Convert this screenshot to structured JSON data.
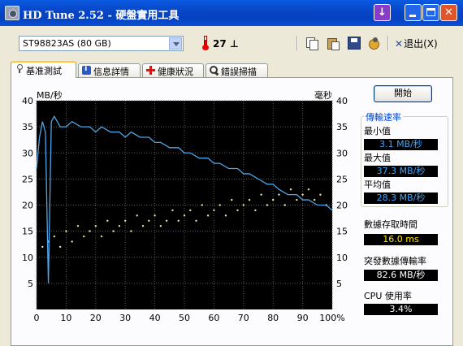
{
  "window": {
    "title": "HD Tune 2.52 - 硬盤實用工具"
  },
  "toolbar": {
    "drive": "ST98823AS (80 GB)",
    "temperature": "27 ⊥",
    "exit_label": "退出(X)"
  },
  "tabs": [
    {
      "label": "基准測試",
      "active": true
    },
    {
      "label": "信息詳情"
    },
    {
      "label": "健康狀況"
    },
    {
      "label": "錯誤掃描"
    }
  ],
  "benchmark": {
    "start_label": "開始",
    "transfer_rate_title": "傳輸速率",
    "min_label": "最小值",
    "min_value": "3.1 MB/秒",
    "max_label": "最大值",
    "max_value": "37.3 MB/秒",
    "avg_label": "平均值",
    "avg_value": "28.3 MB/秒",
    "access_time_label": "數據存取時間",
    "access_time_value": "16.0 ms",
    "burst_rate_label": "突發數據傳輸率",
    "burst_rate_value": "82.6 MB/秒",
    "cpu_label": "CPU 使用率",
    "cpu_value": "3.4%"
  },
  "colors": {
    "titlebar": "#0a5ae0",
    "chart_bg": "#000000",
    "transfer_line": "#4ea6e8",
    "access_dots": "#e6e6a0",
    "group_title": "#0046d5"
  },
  "chart_data": {
    "type": "line",
    "xlabel": "",
    "ylabel_left": "MB/秒",
    "ylabel_right": "毫秒",
    "xlim": [
      0,
      100
    ],
    "ylim": [
      0,
      40
    ],
    "x_ticks": [
      "0",
      "10",
      "20",
      "30",
      "40",
      "50",
      "60",
      "70",
      "80",
      "90",
      "100%"
    ],
    "y_ticks": [
      "5",
      "10",
      "15",
      "20",
      "25",
      "30",
      "35",
      "40"
    ],
    "grid": true,
    "series": [
      {
        "name": "transfer rate",
        "x": [
          0,
          1,
          2,
          3,
          4,
          5,
          6,
          7,
          8,
          10,
          12,
          15,
          18,
          20,
          22,
          25,
          28,
          30,
          32,
          35,
          38,
          40,
          42,
          45,
          48,
          50,
          52,
          55,
          58,
          60,
          62,
          65,
          68,
          70,
          72,
          75,
          78,
          80,
          82,
          85,
          88,
          90,
          92,
          95,
          98,
          100
        ],
        "y": [
          27,
          33,
          36,
          34,
          5,
          36,
          37,
          36,
          35,
          35,
          36,
          35,
          35,
          34,
          35,
          34,
          34,
          33,
          34,
          33,
          33,
          32,
          32,
          31,
          31,
          30,
          30,
          29,
          29,
          28,
          28,
          27,
          27,
          26,
          26,
          25,
          24,
          24,
          23,
          22,
          22,
          21,
          21,
          20,
          20,
          19
        ]
      },
      {
        "name": "access time",
        "type": "scatter",
        "x": [
          2,
          4,
          6,
          8,
          10,
          12,
          14,
          16,
          18,
          20,
          22,
          24,
          26,
          28,
          30,
          32,
          34,
          36,
          38,
          40,
          42,
          44,
          46,
          48,
          50,
          52,
          54,
          56,
          58,
          60,
          62,
          64,
          66,
          68,
          70,
          72,
          74,
          76,
          78,
          80,
          82,
          84,
          86,
          88,
          90,
          92,
          94,
          96,
          98
        ],
        "y": [
          12,
          13,
          14,
          12,
          15,
          13,
          16,
          14,
          15,
          16,
          14,
          17,
          15,
          16,
          17,
          15,
          18,
          16,
          17,
          18,
          16,
          17,
          19,
          17,
          18,
          19,
          17,
          20,
          18,
          19,
          20,
          18,
          21,
          19,
          20,
          21,
          19,
          22,
          20,
          21,
          22,
          20,
          23,
          21,
          22,
          23,
          21,
          22,
          20
        ]
      }
    ]
  }
}
